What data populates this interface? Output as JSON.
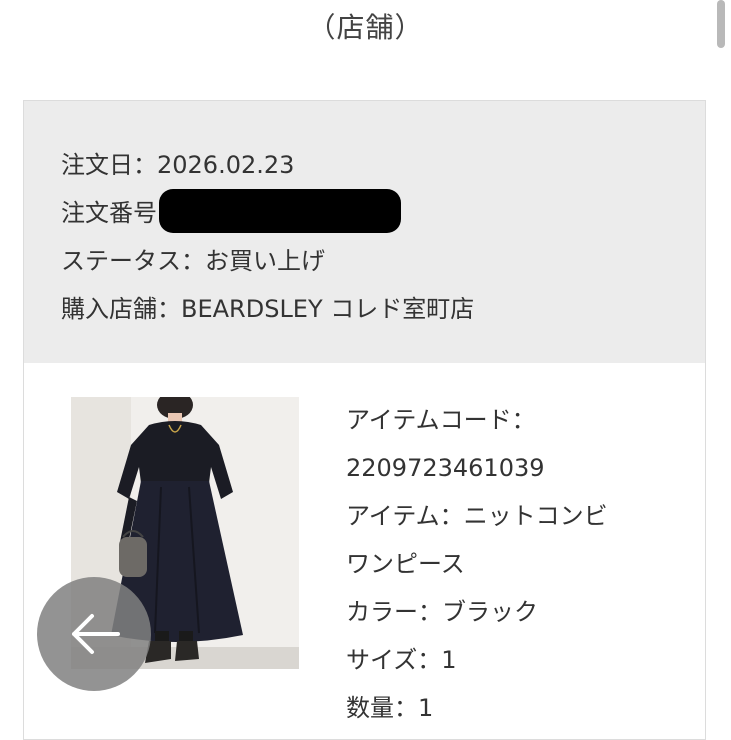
{
  "page": {
    "title": "（店舗）"
  },
  "order": {
    "date_label": "注文日：",
    "date_value": "2026.02.23",
    "number_label": "注文番号",
    "status_label": "ステータス：",
    "status_value": "お買い上げ",
    "store_label": "購入店舗：",
    "store_value": "BEARDSLEY コレド室町店"
  },
  "item": {
    "code_label": "アイテムコード：",
    "code_value": "2209723461039",
    "name_label": "アイテム：",
    "name_value_line1": "ニットコンビ",
    "name_value_line2": "ワンピース",
    "color_label": "カラー：",
    "color_value": "ブラック",
    "size_label": "サイズ：",
    "size_value": "1",
    "quantity_label": "数量：",
    "quantity_value": "1"
  },
  "icons": {
    "back": "arrow-left-icon"
  },
  "colors": {
    "header_bg": "#ececec",
    "back_button_bg": "#808080",
    "dress": "#1f2130"
  }
}
